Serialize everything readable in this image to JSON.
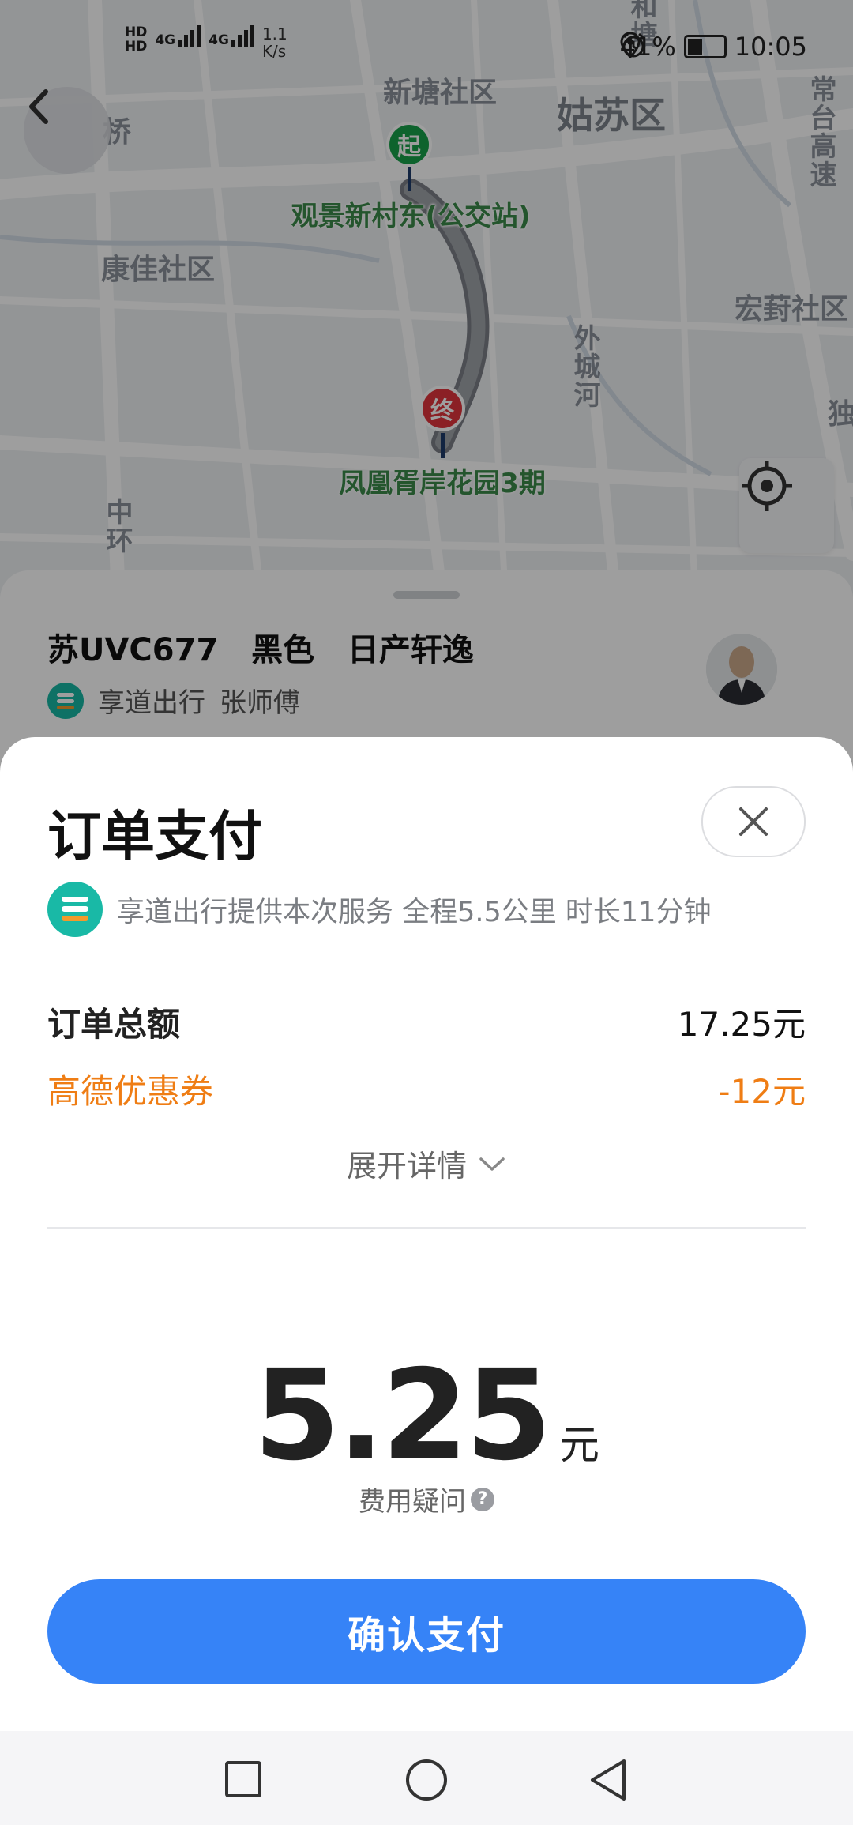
{
  "status_bar": {
    "network_hd1": "HD",
    "network_hd2": "HD",
    "signal1": "4G",
    "signal2": "4G",
    "speed": "1.1",
    "speed_unit": "K/s",
    "battery_percent": "41%",
    "time": "10:05"
  },
  "map": {
    "labels": {
      "xintang": "新塘社区",
      "gusu": "姑苏区",
      "qiao": "桥",
      "kangjia": "康佳社区",
      "hongfu": "宏葑社区",
      "waichenghe": "外城河",
      "changtai": "常台高速",
      "zhonghuan": "中环",
      "he": "和塘",
      "du": "独"
    },
    "start_pin": "起",
    "end_pin": "终",
    "start_name": "观景新村东(公交站)",
    "end_name": "凤凰胥岸花园3期"
  },
  "driver": {
    "car_info": "苏UVC677   黑色   日产轩逸",
    "service": "享道出行",
    "driver_name": "张师傅"
  },
  "payment": {
    "title": "订单支付",
    "service_desc": "享道出行提供本次服务 全程5.5公里 时长11分钟",
    "total_label": "订单总额",
    "total_value": "17.25元",
    "coupon_label": "高德优惠券",
    "coupon_value": "-12元",
    "expand_label": "展开详情",
    "amount": "5.25",
    "amount_unit": "元",
    "fee_question": "费用疑问",
    "confirm_label": "确认支付"
  },
  "colors": {
    "accent_blue": "#3683f7",
    "coupon_orange": "#ef7d14",
    "brand_teal": "#19b9a6"
  }
}
